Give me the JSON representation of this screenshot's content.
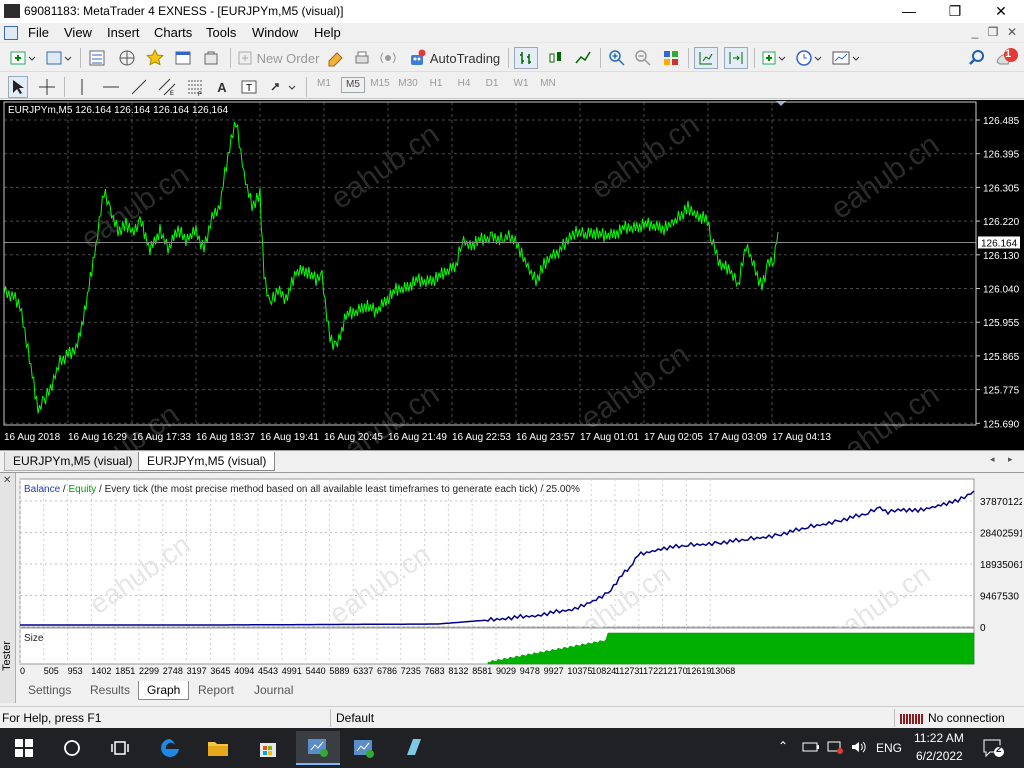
{
  "window": {
    "title": "69081183: MetaTrader 4 EXNESS - [EURJPYm,M5 (visual)]",
    "controls": {
      "minimize": "—",
      "maximize": "❐",
      "close": "✕"
    }
  },
  "menu": {
    "items": [
      "File",
      "View",
      "Insert",
      "Charts",
      "Tools",
      "Window",
      "Help"
    ],
    "mdi": {
      "minimize": "_",
      "restore": "❐",
      "close": "✕"
    }
  },
  "toolbar": {
    "new_order": "New Order",
    "auto_trading": "AutoTrading",
    "notification_count": "1"
  },
  "timeframes": [
    "M1",
    "M5",
    "M15",
    "M30",
    "H1",
    "H4",
    "D1",
    "W1",
    "MN"
  ],
  "active_timeframe": "M5",
  "chart": {
    "header": "EURJPYm,M5  126.164 126.164 126.164 126,164",
    "current_price": "126.164",
    "price_axis": [
      "126.485",
      "126.395",
      "126.305",
      "126.220",
      "126.130",
      "126.040",
      "125.955",
      "125.865",
      "125.775",
      "125.690"
    ],
    "time_axis": [
      "16 Aug 2018",
      "16 Aug 16:29",
      "16 Aug 17:33",
      "16 Aug 18:37",
      "16 Aug 19:41",
      "16 Aug 20:45",
      "16 Aug 21:49",
      "16 Aug 22:53",
      "16 Aug 23:57",
      "17 Aug 01:01",
      "17 Aug 02:05",
      "17 Aug 03:09",
      "17 Aug 04:13"
    ],
    "watermark": "eahub.cn",
    "colors": {
      "background": "#000000",
      "line": "#00ff00",
      "grid": "#5a5a5a"
    }
  },
  "chart_tabs": [
    "EURJPYm,M5 (visual)",
    "EURJPYm,M5 (visual)"
  ],
  "tester": {
    "side_label": "Tester",
    "legend": {
      "balance": "Balance",
      "sep1": " / ",
      "equity": "Equity",
      "rest": " / Every tick (the most precise method based on all available least timeframes to generate each tick) / 25.00%"
    },
    "size_label": "Size",
    "y_axis": [
      "37870122",
      "28402591",
      "18935061",
      "9467530",
      "0"
    ],
    "x_axis": [
      "0",
      "505",
      "953",
      "1402",
      "1851",
      "2299",
      "2748",
      "3197",
      "3645",
      "4094",
      "4543",
      "4991",
      "5440",
      "5889",
      "6337",
      "6786",
      "7235",
      "7683",
      "8132",
      "8581",
      "9029",
      "9478",
      "9927",
      "10375",
      "10824",
      "11273",
      "11722",
      "12170",
      "12619",
      "13068"
    ],
    "tabs": [
      "Settings",
      "Results",
      "Graph",
      "Report",
      "Journal"
    ],
    "active_tab": "Graph",
    "colors": {
      "balance": "#00008b",
      "equity": "#00a000",
      "size": "#00b000"
    }
  },
  "status": {
    "help": "For Help, press F1",
    "profile": "Default",
    "connection": "No connection"
  },
  "taskbar": {
    "language": "ENG",
    "time": "11:22 AM",
    "date": "6/2/2022",
    "notifications": "2"
  }
}
